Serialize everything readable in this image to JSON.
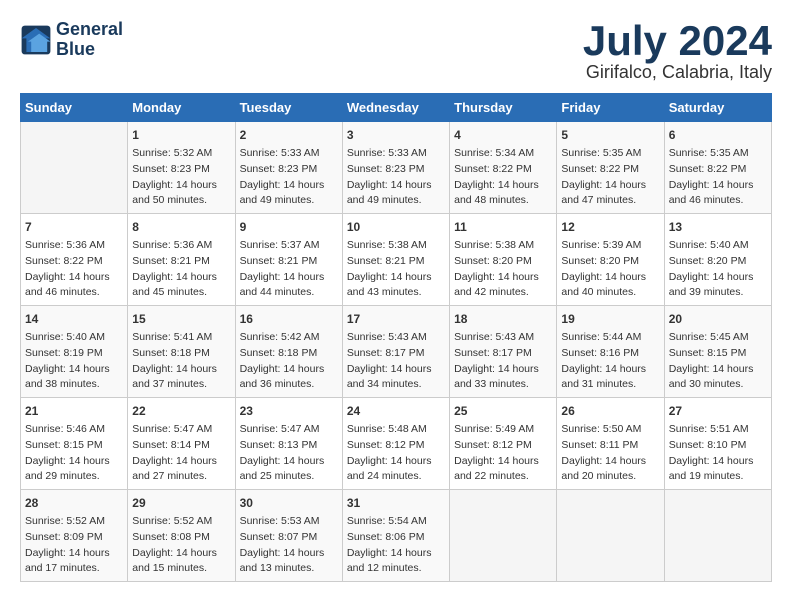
{
  "logo": {
    "line1": "General",
    "line2": "Blue"
  },
  "title": "July 2024",
  "subtitle": "Girifalco, Calabria, Italy",
  "headers": [
    "Sunday",
    "Monday",
    "Tuesday",
    "Wednesday",
    "Thursday",
    "Friday",
    "Saturday"
  ],
  "weeks": [
    [
      {
        "day": "",
        "content": ""
      },
      {
        "day": "1",
        "content": "Sunrise: 5:32 AM\nSunset: 8:23 PM\nDaylight: 14 hours\nand 50 minutes."
      },
      {
        "day": "2",
        "content": "Sunrise: 5:33 AM\nSunset: 8:23 PM\nDaylight: 14 hours\nand 49 minutes."
      },
      {
        "day": "3",
        "content": "Sunrise: 5:33 AM\nSunset: 8:23 PM\nDaylight: 14 hours\nand 49 minutes."
      },
      {
        "day": "4",
        "content": "Sunrise: 5:34 AM\nSunset: 8:22 PM\nDaylight: 14 hours\nand 48 minutes."
      },
      {
        "day": "5",
        "content": "Sunrise: 5:35 AM\nSunset: 8:22 PM\nDaylight: 14 hours\nand 47 minutes."
      },
      {
        "day": "6",
        "content": "Sunrise: 5:35 AM\nSunset: 8:22 PM\nDaylight: 14 hours\nand 46 minutes."
      }
    ],
    [
      {
        "day": "7",
        "content": "Sunrise: 5:36 AM\nSunset: 8:22 PM\nDaylight: 14 hours\nand 46 minutes."
      },
      {
        "day": "8",
        "content": "Sunrise: 5:36 AM\nSunset: 8:21 PM\nDaylight: 14 hours\nand 45 minutes."
      },
      {
        "day": "9",
        "content": "Sunrise: 5:37 AM\nSunset: 8:21 PM\nDaylight: 14 hours\nand 44 minutes."
      },
      {
        "day": "10",
        "content": "Sunrise: 5:38 AM\nSunset: 8:21 PM\nDaylight: 14 hours\nand 43 minutes."
      },
      {
        "day": "11",
        "content": "Sunrise: 5:38 AM\nSunset: 8:20 PM\nDaylight: 14 hours\nand 42 minutes."
      },
      {
        "day": "12",
        "content": "Sunrise: 5:39 AM\nSunset: 8:20 PM\nDaylight: 14 hours\nand 40 minutes."
      },
      {
        "day": "13",
        "content": "Sunrise: 5:40 AM\nSunset: 8:20 PM\nDaylight: 14 hours\nand 39 minutes."
      }
    ],
    [
      {
        "day": "14",
        "content": "Sunrise: 5:40 AM\nSunset: 8:19 PM\nDaylight: 14 hours\nand 38 minutes."
      },
      {
        "day": "15",
        "content": "Sunrise: 5:41 AM\nSunset: 8:18 PM\nDaylight: 14 hours\nand 37 minutes."
      },
      {
        "day": "16",
        "content": "Sunrise: 5:42 AM\nSunset: 8:18 PM\nDaylight: 14 hours\nand 36 minutes."
      },
      {
        "day": "17",
        "content": "Sunrise: 5:43 AM\nSunset: 8:17 PM\nDaylight: 14 hours\nand 34 minutes."
      },
      {
        "day": "18",
        "content": "Sunrise: 5:43 AM\nSunset: 8:17 PM\nDaylight: 14 hours\nand 33 minutes."
      },
      {
        "day": "19",
        "content": "Sunrise: 5:44 AM\nSunset: 8:16 PM\nDaylight: 14 hours\nand 31 minutes."
      },
      {
        "day": "20",
        "content": "Sunrise: 5:45 AM\nSunset: 8:15 PM\nDaylight: 14 hours\nand 30 minutes."
      }
    ],
    [
      {
        "day": "21",
        "content": "Sunrise: 5:46 AM\nSunset: 8:15 PM\nDaylight: 14 hours\nand 29 minutes."
      },
      {
        "day": "22",
        "content": "Sunrise: 5:47 AM\nSunset: 8:14 PM\nDaylight: 14 hours\nand 27 minutes."
      },
      {
        "day": "23",
        "content": "Sunrise: 5:47 AM\nSunset: 8:13 PM\nDaylight: 14 hours\nand 25 minutes."
      },
      {
        "day": "24",
        "content": "Sunrise: 5:48 AM\nSunset: 8:12 PM\nDaylight: 14 hours\nand 24 minutes."
      },
      {
        "day": "25",
        "content": "Sunrise: 5:49 AM\nSunset: 8:12 PM\nDaylight: 14 hours\nand 22 minutes."
      },
      {
        "day": "26",
        "content": "Sunrise: 5:50 AM\nSunset: 8:11 PM\nDaylight: 14 hours\nand 20 minutes."
      },
      {
        "day": "27",
        "content": "Sunrise: 5:51 AM\nSunset: 8:10 PM\nDaylight: 14 hours\nand 19 minutes."
      }
    ],
    [
      {
        "day": "28",
        "content": "Sunrise: 5:52 AM\nSunset: 8:09 PM\nDaylight: 14 hours\nand 17 minutes."
      },
      {
        "day": "29",
        "content": "Sunrise: 5:52 AM\nSunset: 8:08 PM\nDaylight: 14 hours\nand 15 minutes."
      },
      {
        "day": "30",
        "content": "Sunrise: 5:53 AM\nSunset: 8:07 PM\nDaylight: 14 hours\nand 13 minutes."
      },
      {
        "day": "31",
        "content": "Sunrise: 5:54 AM\nSunset: 8:06 PM\nDaylight: 14 hours\nand 12 minutes."
      },
      {
        "day": "",
        "content": ""
      },
      {
        "day": "",
        "content": ""
      },
      {
        "day": "",
        "content": ""
      }
    ]
  ]
}
